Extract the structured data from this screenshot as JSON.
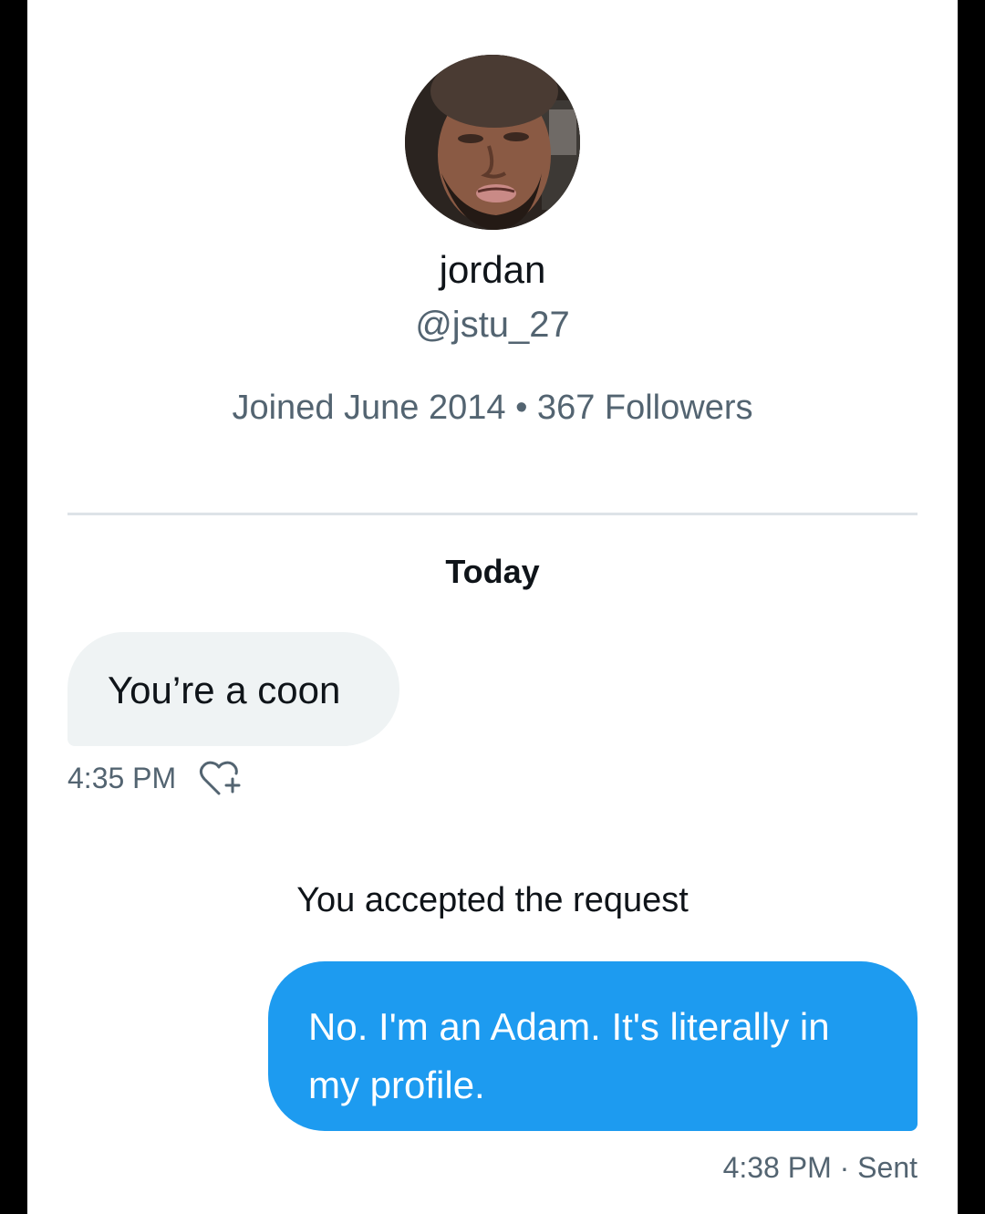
{
  "profile": {
    "avatar_icon": "user-avatar-photo",
    "name": "jordan",
    "handle": "@jstu_27",
    "meta": "Joined June 2014 • 367 Followers"
  },
  "conversation": {
    "date_separator": "Today",
    "messages": [
      {
        "direction": "incoming",
        "text": "You’re a coon",
        "time": "4:35 PM",
        "reaction_icon": "heart-plus-icon"
      },
      {
        "direction": "system",
        "text": "You accepted the request"
      },
      {
        "direction": "outgoing",
        "text": "No. I'm an Adam. It's literally in my profile.",
        "status": "4:38 PM · Sent"
      }
    ]
  },
  "colors": {
    "background": "#ffffff",
    "outgoing_bubble": "#1d9bf0",
    "incoming_bubble": "#eff3f4",
    "secondary_text": "#536471",
    "primary_text": "#0f1419"
  }
}
